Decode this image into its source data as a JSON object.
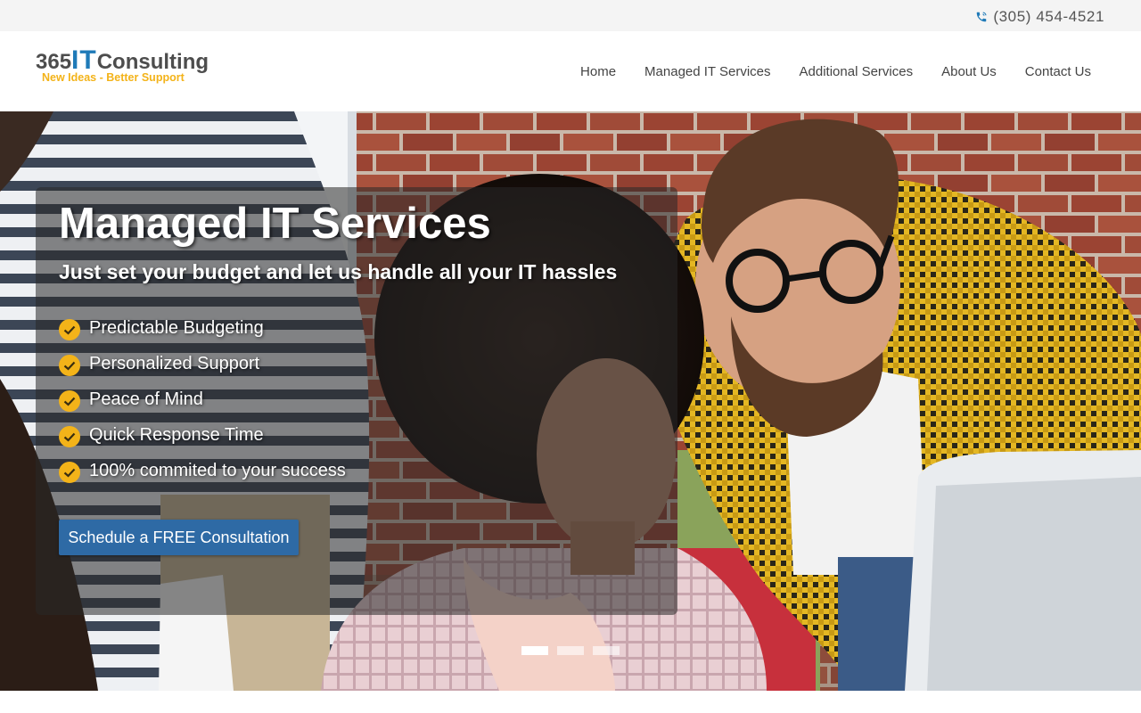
{
  "topbar": {
    "phone_icon": "phone-icon",
    "phone": "(305) 454-4521"
  },
  "logo": {
    "part1": "365",
    "part2": "IT",
    "part3": "Consulting",
    "tagline": "New Ideas - Better Support"
  },
  "nav": {
    "items": [
      {
        "label": "Home"
      },
      {
        "label": "Managed IT Services"
      },
      {
        "label": "Additional Services"
      },
      {
        "label": "About Us"
      },
      {
        "label": "Contact Us"
      }
    ]
  },
  "hero": {
    "title": "Managed IT Services",
    "subtitle": "Just set your budget and let us handle all your IT hassles",
    "features": [
      {
        "label": "Predictable Budgeting",
        "icon": "check-circle-icon"
      },
      {
        "label": "Personalized Support",
        "icon": "check-circle-icon"
      },
      {
        "label": "Peace of Mind",
        "icon": "check-circle-icon"
      },
      {
        "label": "Quick Response Time",
        "icon": "check-circle-icon"
      },
      {
        "label": "100% commited to your success",
        "icon": "check-circle-icon"
      }
    ],
    "cta_label": "Schedule a FREE Consultation",
    "slides": 3,
    "active_slide": 1
  },
  "colors": {
    "accent_yellow": "#f3b319",
    "brand_blue": "#1f7ab8",
    "cta_blue": "#2e6aa5"
  }
}
